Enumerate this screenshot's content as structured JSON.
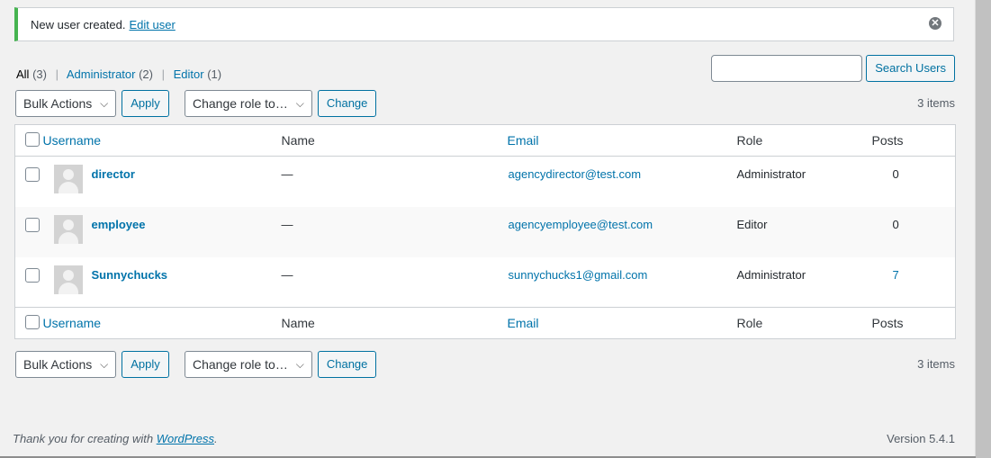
{
  "notice": {
    "message": "New user created.",
    "link": "Edit user"
  },
  "views": [
    {
      "label": "All",
      "count": "(3)"
    },
    {
      "label": "Administrator",
      "count": "(2)"
    },
    {
      "label": "Editor",
      "count": "(1)"
    }
  ],
  "search": {
    "button": "Search Users",
    "value": ""
  },
  "tablenav": {
    "bulk_actions": "Bulk Actions",
    "apply": "Apply",
    "change_role": "Change role to…",
    "change": "Change",
    "items": "3 items"
  },
  "columns": {
    "username": "Username",
    "name": "Name",
    "email": "Email",
    "role": "Role",
    "posts": "Posts"
  },
  "users": [
    {
      "username": "director",
      "name": "—",
      "email": "agencydirector@test.com",
      "role": "Administrator",
      "posts": "0"
    },
    {
      "username": "employee",
      "name": "—",
      "email": "agencyemployee@test.com",
      "role": "Editor",
      "posts": "0"
    },
    {
      "username": "Sunnychucks",
      "name": "—",
      "email": "sunnychucks1@gmail.com",
      "role": "Administrator",
      "posts": "7"
    }
  ],
  "footer": {
    "thanks_prefix": "Thank you for creating with",
    "wordpress": "WordPress",
    "thanks_suffix": ".",
    "version": "Version 5.4.1"
  },
  "icons": {
    "dismiss": "dismiss-icon",
    "chevron": "chevron-down-icon",
    "avatar": "avatar-placeholder"
  }
}
